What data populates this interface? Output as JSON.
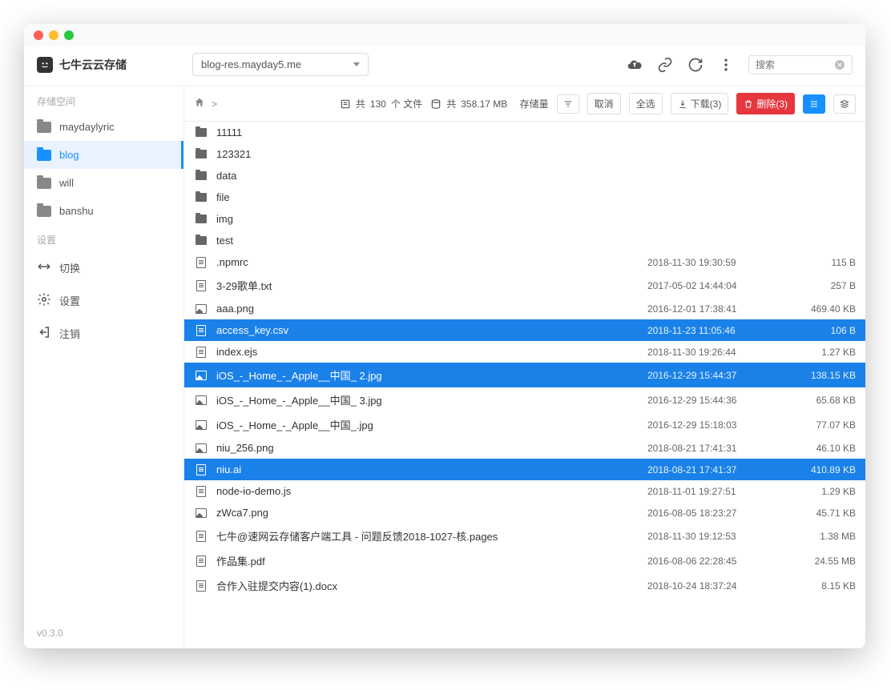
{
  "brand": {
    "title": "七牛云云存储"
  },
  "bucket": {
    "selected": "blog-res.mayday5.me"
  },
  "search": {
    "placeholder": "搜索"
  },
  "sidebar": {
    "section_storage": "存储空间",
    "section_settings": "设置",
    "buckets": [
      {
        "label": "maydaylyric",
        "active": false
      },
      {
        "label": "blog",
        "active": true
      },
      {
        "label": "will",
        "active": false
      },
      {
        "label": "banshu",
        "active": false
      }
    ],
    "settings": [
      {
        "label": "切换",
        "icon": "switch"
      },
      {
        "label": "设置",
        "icon": "gear"
      },
      {
        "label": "注销",
        "icon": "logout"
      }
    ]
  },
  "version": "v0.3.0",
  "toolbar": {
    "breadcrumb_sep": ">",
    "file_count_prefix": "共",
    "file_count": "130",
    "file_count_suffix": "个 文件",
    "storage_prefix": "共",
    "storage_size": "358.17 MB",
    "storage_suffix": "存储量",
    "cancel": "取消",
    "select_all": "全选",
    "download": "下载(3)",
    "delete": "删除(3)"
  },
  "files": [
    {
      "type": "folder",
      "name": "11111",
      "date": "",
      "size": "",
      "selected": false
    },
    {
      "type": "folder",
      "name": "123321",
      "date": "",
      "size": "",
      "selected": false
    },
    {
      "type": "folder",
      "name": "data",
      "date": "",
      "size": "",
      "selected": false
    },
    {
      "type": "folder",
      "name": "file",
      "date": "",
      "size": "",
      "selected": false
    },
    {
      "type": "folder",
      "name": "img",
      "date": "",
      "size": "",
      "selected": false
    },
    {
      "type": "folder",
      "name": "test",
      "date": "",
      "size": "",
      "selected": false
    },
    {
      "type": "file",
      "name": ".npmrc",
      "date": "2018-11-30 19:30:59",
      "size": "115 B",
      "selected": false
    },
    {
      "type": "file",
      "name": "3-29歌单.txt",
      "date": "2017-05-02 14:44:04",
      "size": "257 B",
      "selected": false
    },
    {
      "type": "image",
      "name": "aaa.png",
      "date": "2016-12-01 17:38:41",
      "size": "469.40 KB",
      "selected": false
    },
    {
      "type": "file",
      "name": "access_key.csv",
      "date": "2018-11-23 11:05:46",
      "size": "106 B",
      "selected": true
    },
    {
      "type": "file",
      "name": "index.ejs",
      "date": "2018-11-30 19:26:44",
      "size": "1.27 KB",
      "selected": false
    },
    {
      "type": "image",
      "name": "iOS_-_Home_-_Apple__中国_ 2.jpg",
      "date": "2016-12-29 15:44:37",
      "size": "138.15 KB",
      "selected": true
    },
    {
      "type": "image",
      "name": "iOS_-_Home_-_Apple__中国_ 3.jpg",
      "date": "2016-12-29 15:44:36",
      "size": "65.68 KB",
      "selected": false
    },
    {
      "type": "image",
      "name": "iOS_-_Home_-_Apple__中国_.jpg",
      "date": "2016-12-29 15:18:03",
      "size": "77.07 KB",
      "selected": false
    },
    {
      "type": "image",
      "name": "niu_256.png",
      "date": "2018-08-21 17:41:31",
      "size": "46.10 KB",
      "selected": false
    },
    {
      "type": "file",
      "name": "niu.ai",
      "date": "2018-08-21 17:41:37",
      "size": "410.89 KB",
      "selected": true
    },
    {
      "type": "file",
      "name": "node-io-demo.js",
      "date": "2018-11-01 19:27:51",
      "size": "1.29 KB",
      "selected": false
    },
    {
      "type": "image",
      "name": "zWca7.png",
      "date": "2016-08-05 18:23:27",
      "size": "45.71 KB",
      "selected": false
    },
    {
      "type": "file",
      "name": "七牛@速网云存储客户端工具 - 问题反馈2018-1027-核.pages",
      "date": "2018-11-30 19:12:53",
      "size": "1.38 MB",
      "selected": false
    },
    {
      "type": "file",
      "name": "作品集.pdf",
      "date": "2016-08-06 22:28:45",
      "size": "24.55 MB",
      "selected": false
    },
    {
      "type": "file",
      "name": "合作入驻提交内容(1).docx",
      "date": "2018-10-24 18:37:24",
      "size": "8.15 KB",
      "selected": false
    }
  ]
}
